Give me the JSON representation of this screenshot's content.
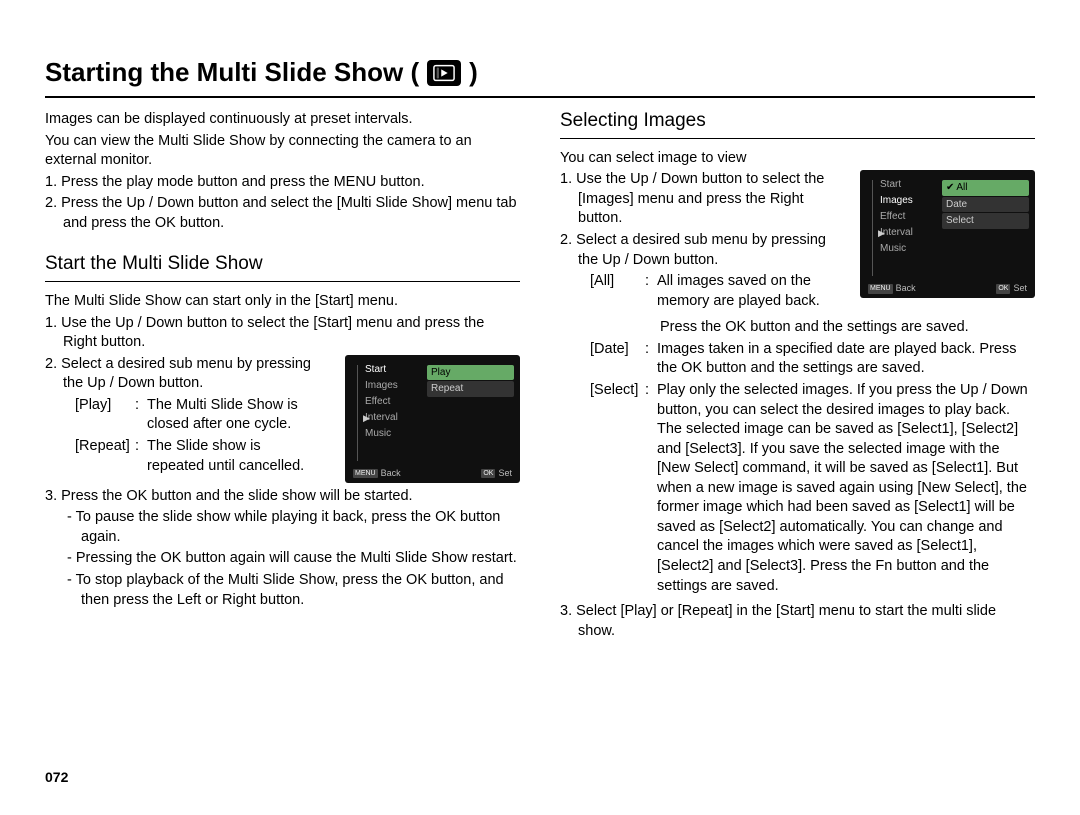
{
  "page_number": "072",
  "title": "Starting the Multi Slide Show (",
  "title_after": " )",
  "intro": [
    "Images can be displayed continuously at preset intervals.",
    "You can view the Multi Slide Show by connecting the camera to an external monitor."
  ],
  "intro_steps": [
    "1. Press the play mode button and press the MENU button.",
    "2. Press the Up / Down button and select the [Multi Slide Show] menu tab and press the OK button."
  ],
  "left": {
    "heading": "Start the Multi Slide Show",
    "lead": "The Multi Slide Show can start only in the [Start] menu.",
    "step1": "1. Use the Up / Down button to select the [Start] menu and press the Right button.",
    "step2": "2. Select a desired sub menu by pressing the Up / Down button.",
    "defs": [
      {
        "label": "[Play]",
        "desc": "The Multi Slide Show is closed after one cycle."
      },
      {
        "label": "[Repeat]",
        "desc": "The Slide show is repeated until cancelled."
      }
    ],
    "step3": "3. Press the OK button and the slide show will be started.",
    "subs": [
      "- To pause the slide show while playing it back, press the OK button again.",
      "- Pressing the OK button again will cause the Multi Slide Show restart.",
      "- To stop playback of the Multi Slide Show, press the OK button, and then press the Left or Right button."
    ],
    "screenshot": {
      "menu": [
        "Start",
        "Images",
        "Effect",
        "Interval",
        "Music"
      ],
      "highlight_index": 0,
      "playicon_index": 3,
      "options": [
        "Play",
        "Repeat"
      ],
      "selected_index": 0,
      "back_key": "MENU",
      "back": "Back",
      "set_key": "OK",
      "set": "Set"
    }
  },
  "right": {
    "heading": "Selecting Images",
    "lead": "You can select image to view",
    "step1": "1. Use the Up / Down button to select the [Images] menu and press the Right button.",
    "step2": "2. Select a desired sub menu by pressing the Up / Down button.",
    "defs": [
      {
        "label": "[All]",
        "desc": "All images saved on the memory are played back. Press the OK button and the settings are saved."
      },
      {
        "label": "[Date]",
        "desc": "Images taken in a specified date are played back. Press the OK button and the settings are saved."
      },
      {
        "label": "[Select]",
        "desc": "Play only the selected images. If you press the Up / Down button, you can select the desired images to play back. The selected image can be saved as [Select1], [Select2] and [Select3]. If you save the selected image with the [New Select] command, it will be saved as [Select1]. But when a new image is saved again using [New Select], the former image which had been saved as [Select1] will be saved as [Select2] automatically. You can change and cancel the images which were saved as [Select1], [Select2] and [Select3]. Press the Fn button and the settings are saved."
      }
    ],
    "step3": "3. Select [Play] or [Repeat] in the [Start] menu to start the multi slide show.",
    "screenshot": {
      "menu": [
        "Start",
        "Images",
        "Effect",
        "Interval",
        "Music"
      ],
      "highlight_index": 1,
      "playicon_index": 3,
      "options": [
        "All",
        "Date",
        "Select"
      ],
      "selected_index": 0,
      "check_first": true,
      "back_key": "MENU",
      "back": "Back",
      "set_key": "OK",
      "set": "Set"
    }
  }
}
